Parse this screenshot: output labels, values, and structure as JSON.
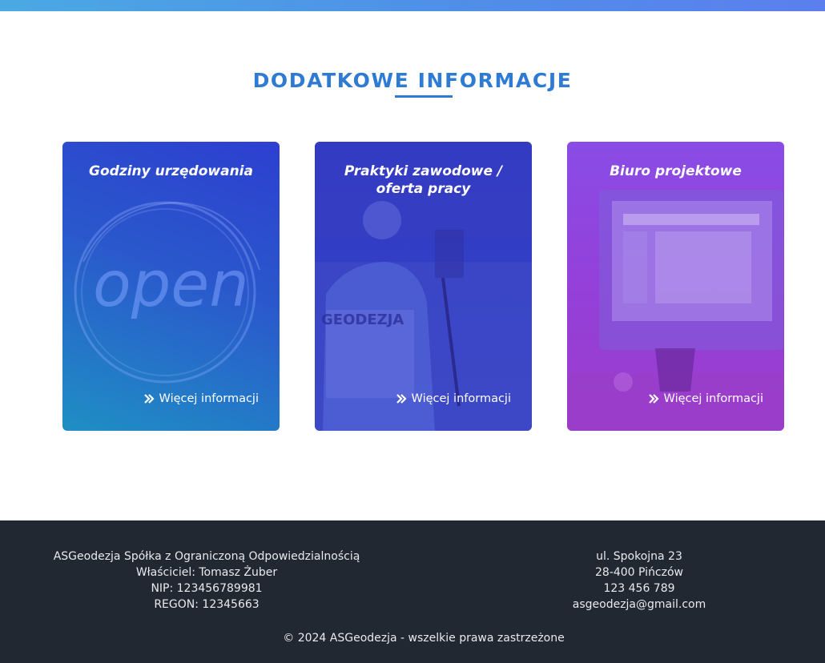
{
  "section": {
    "title": "DODATKOWE INFORMACJE"
  },
  "cards": [
    {
      "title": "Godziny urzędowania",
      "link": "Więcej informacji"
    },
    {
      "title": "Praktyki zawodowe / oferta pracy",
      "link": "Więcej informacji"
    },
    {
      "title": "Biuro projektowe",
      "link": "Więcej informacji"
    }
  ],
  "footer": {
    "company": "ASGeodezja Spółka z Ograniczoną Odpowiedzialnością",
    "owner": "Właściciel: Tomasz Żuber",
    "nip": "NIP: 123456789981",
    "regon": "REGON: 12345663",
    "street": "ul. Spokojna 23",
    "city": "28-400 Pińczów",
    "phone": "123 456 789",
    "email": "asgeodezja@gmail.com",
    "copyright": "© 2024 ASGeodezja - wszelkie prawa zastrzeżone"
  },
  "images": {
    "card_1_art_text": "open",
    "card_2_vest_text": "GEODEZJA"
  },
  "colors": {
    "accent": "#2f7bd3",
    "footer_bg": "#222831"
  }
}
